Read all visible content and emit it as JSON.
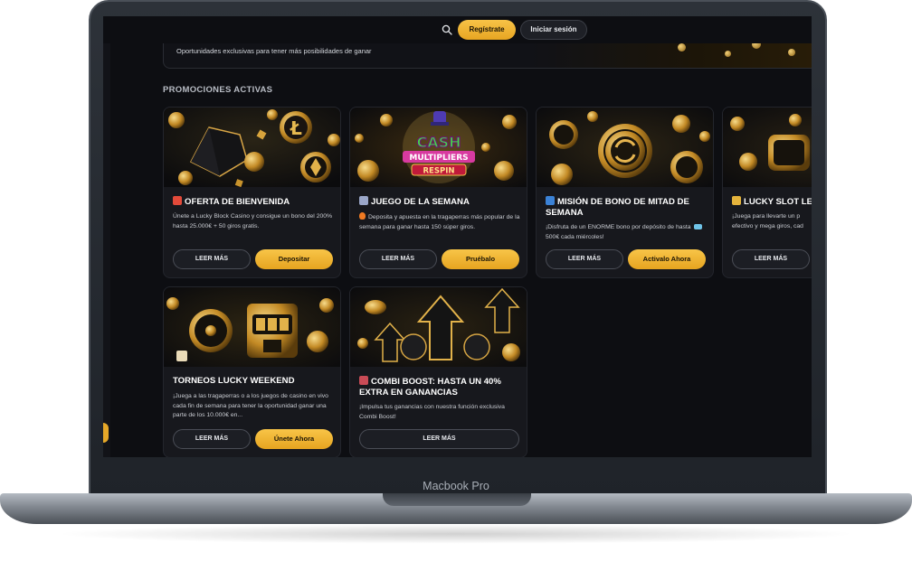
{
  "device": {
    "label": "Macbook Pro"
  },
  "header": {
    "register_label": "Regístrate",
    "login_label": "Iniciar sesión"
  },
  "banner": {
    "text": "Oportunidades exclusivas para tener más posibilidades de ganar"
  },
  "section": {
    "title": "PROMOCIONES ACTIVAS"
  },
  "cards": [
    {
      "title": "OFERTA DE BIENVENIDA",
      "description": "Únete a Lucky Block Casino y consigue un bono del 200% hasta 25.000€ + 50 giros gratis.",
      "more_label": "LEER MÁS",
      "action_label": "Depositar",
      "icon": "gift-icon"
    },
    {
      "title": "JUEGO DE LA SEMANA",
      "description": "Deposita y apuesta en la tragaperras más popular de la semana para ganar hasta 150 súper giros.",
      "more_label": "LEER MÁS",
      "action_label": "Pruébalo",
      "icon": "calendar-icon",
      "thumb_text_1": "CASH",
      "thumb_text_2": "MULTIPLIERS",
      "thumb_text_3": "RESPIN"
    },
    {
      "title": "MISIÓN DE BONO DE MITAD DE SEMANA",
      "description_a": "¡Disfruta de un ENORME bono por depósito de hasta",
      "description_b": "500€ cada miércoles!",
      "more_label": "LEER MÁS",
      "action_label": "Activalo Ahora",
      "icon": "refresh-icon"
    },
    {
      "title": "LUCKY SLOT LE",
      "description": "¡Juega para llevarte un p efectivo y mega giros, cad",
      "more_label": "LEER MÁS",
      "icon": "trophy-icon"
    },
    {
      "title": "TORNEOS LUCKY WEEKEND",
      "description": "¡Juega a las tragaperras o a los juegos de casino en vivo cada fin de semana para tener la oportunidad ganar una parte de los 10.000€ en...",
      "more_label": "LEER MÁS",
      "action_label": "Únete Ahora"
    },
    {
      "title": "COMBI BOOST: HASTA UN 40% EXTRA EN GANANCIAS",
      "description": "¡Impulsa tus ganancias con nuestra función exclusiva Combi Boost!",
      "more_label": "LEER MÁS",
      "icon": "rocket-icon"
    }
  ],
  "colors": {
    "accent": "#f2b63a",
    "background": "#0d0e12",
    "card": "#17181d"
  }
}
